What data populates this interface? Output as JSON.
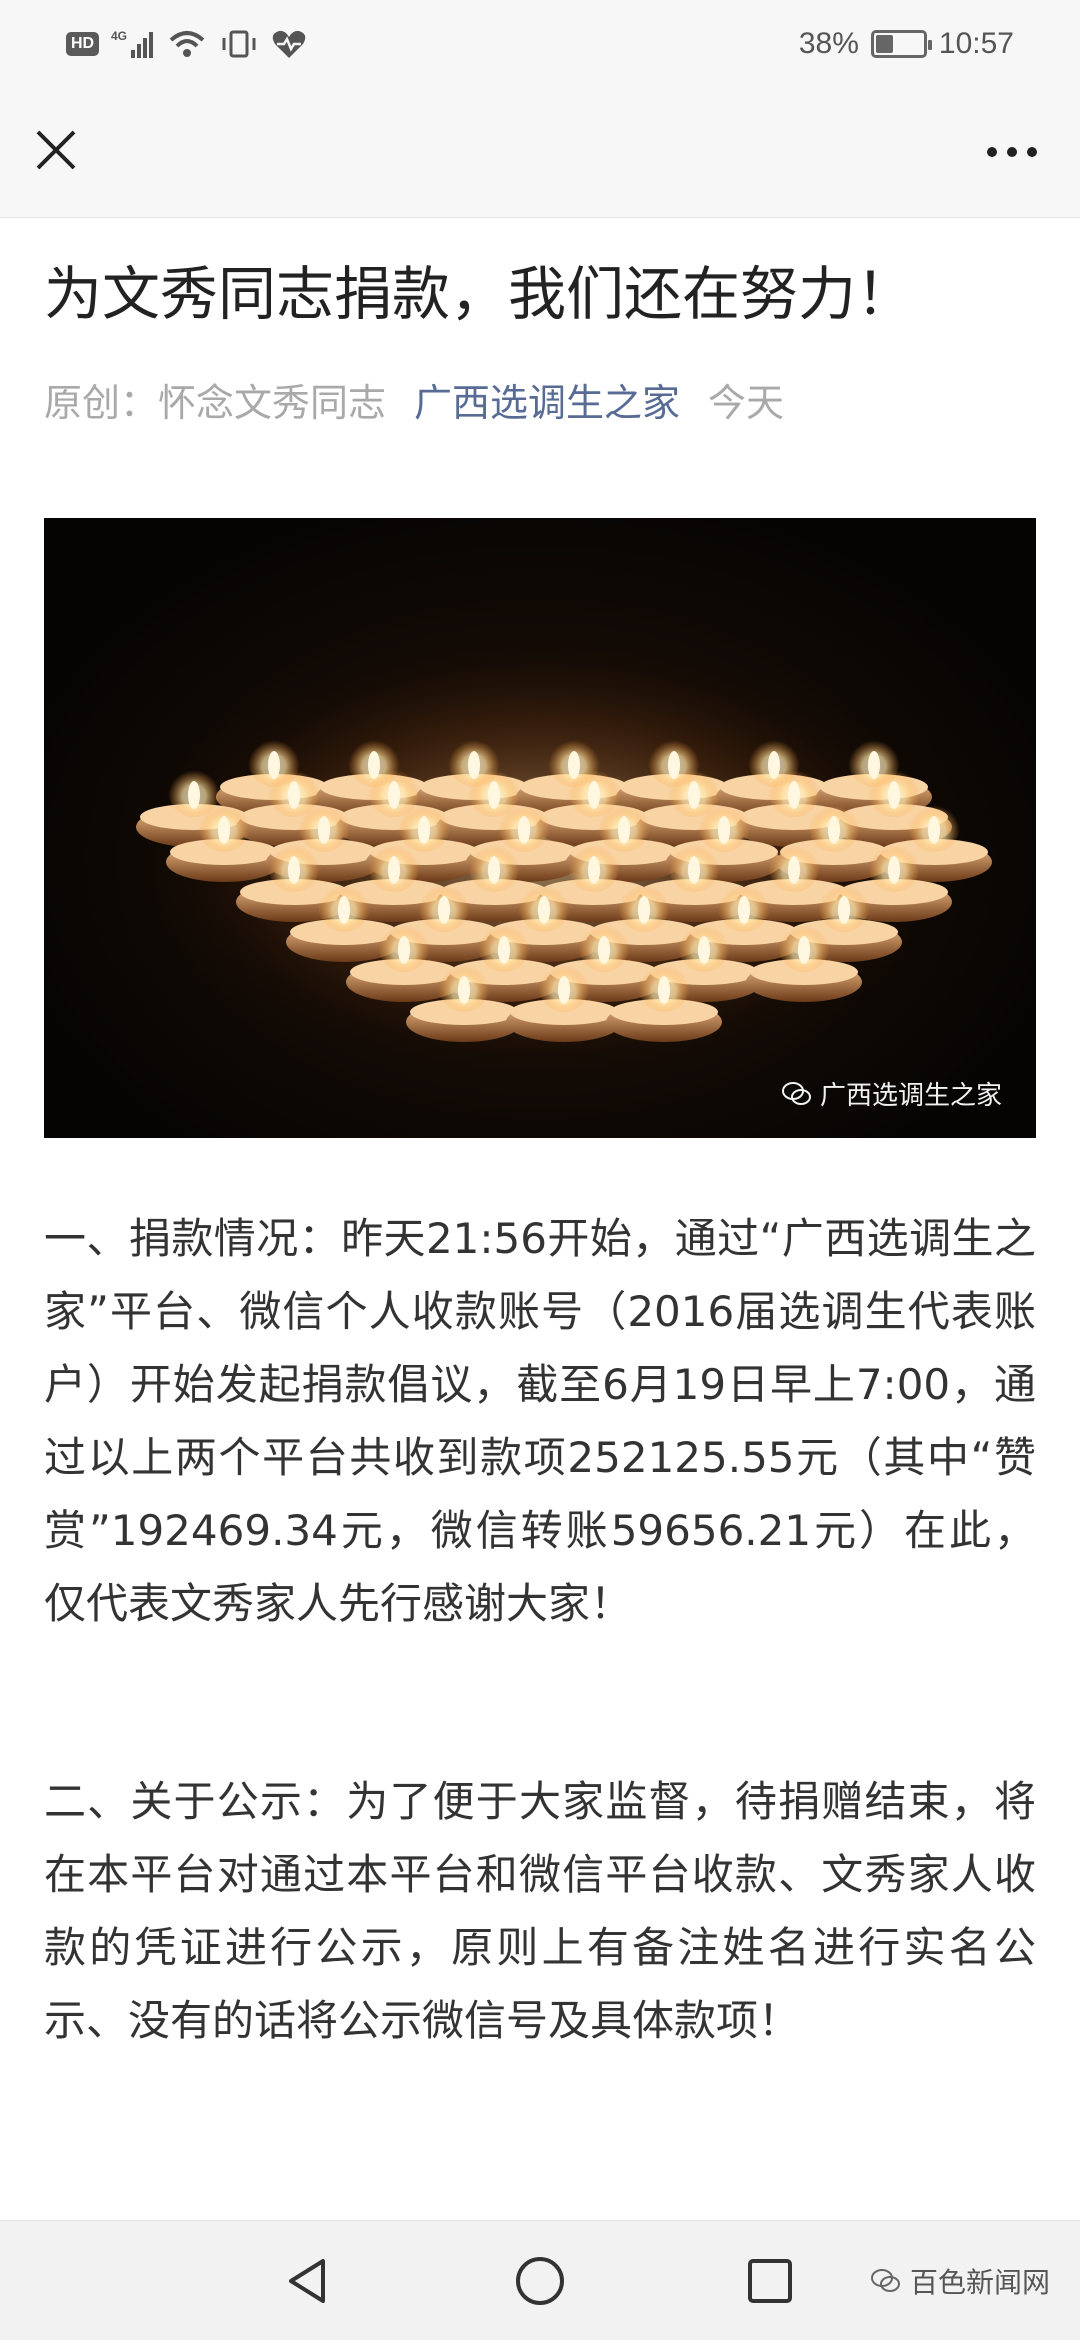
{
  "status_bar": {
    "network_badge": "HD",
    "signal_label": "4G",
    "battery_percent": "38%",
    "battery_level": 0.38,
    "time": "10:57",
    "icons": [
      "signal-icon",
      "wifi-icon",
      "vibrate-icon",
      "heart-health-icon"
    ]
  },
  "nav": {
    "close_icon": "close-icon",
    "more_icon": "more-icon"
  },
  "article": {
    "title": "为文秀同志捐款，我们还在努力！",
    "meta": {
      "original_label": "原创：怀念文秀同志",
      "account": "广西选调生之家",
      "date": "今天"
    },
    "image": {
      "description_icon": "candle-heart-photo",
      "watermark": "广西选调生之家"
    },
    "paragraphs": [
      "一、捐款情况：昨天21:56开始，通过“广西选调生之家”平台、微信个人收款账号（2016届选调生代表账户）开始发起捐款倡议，截至6月19日早上7:00，通过以上两个平台共收到款项252125.55元（其中“赞赏”192469.34元，微信转账59656.21元）在此，仅代表文秀家人先行感谢大家！",
      "二、关于公示：为了便于大家监督，待捐赠结束，将在本平台对通过本平台和微信平台收款、文秀家人收款的凭证进行公示，原则上有备注姓名进行实名公示、没有的话将公示微信号及具体款项！"
    ]
  },
  "bottom_nav": {
    "buttons": [
      "back-icon",
      "home-icon",
      "recent-apps-icon"
    ],
    "source_mark": "百色新闻网"
  }
}
